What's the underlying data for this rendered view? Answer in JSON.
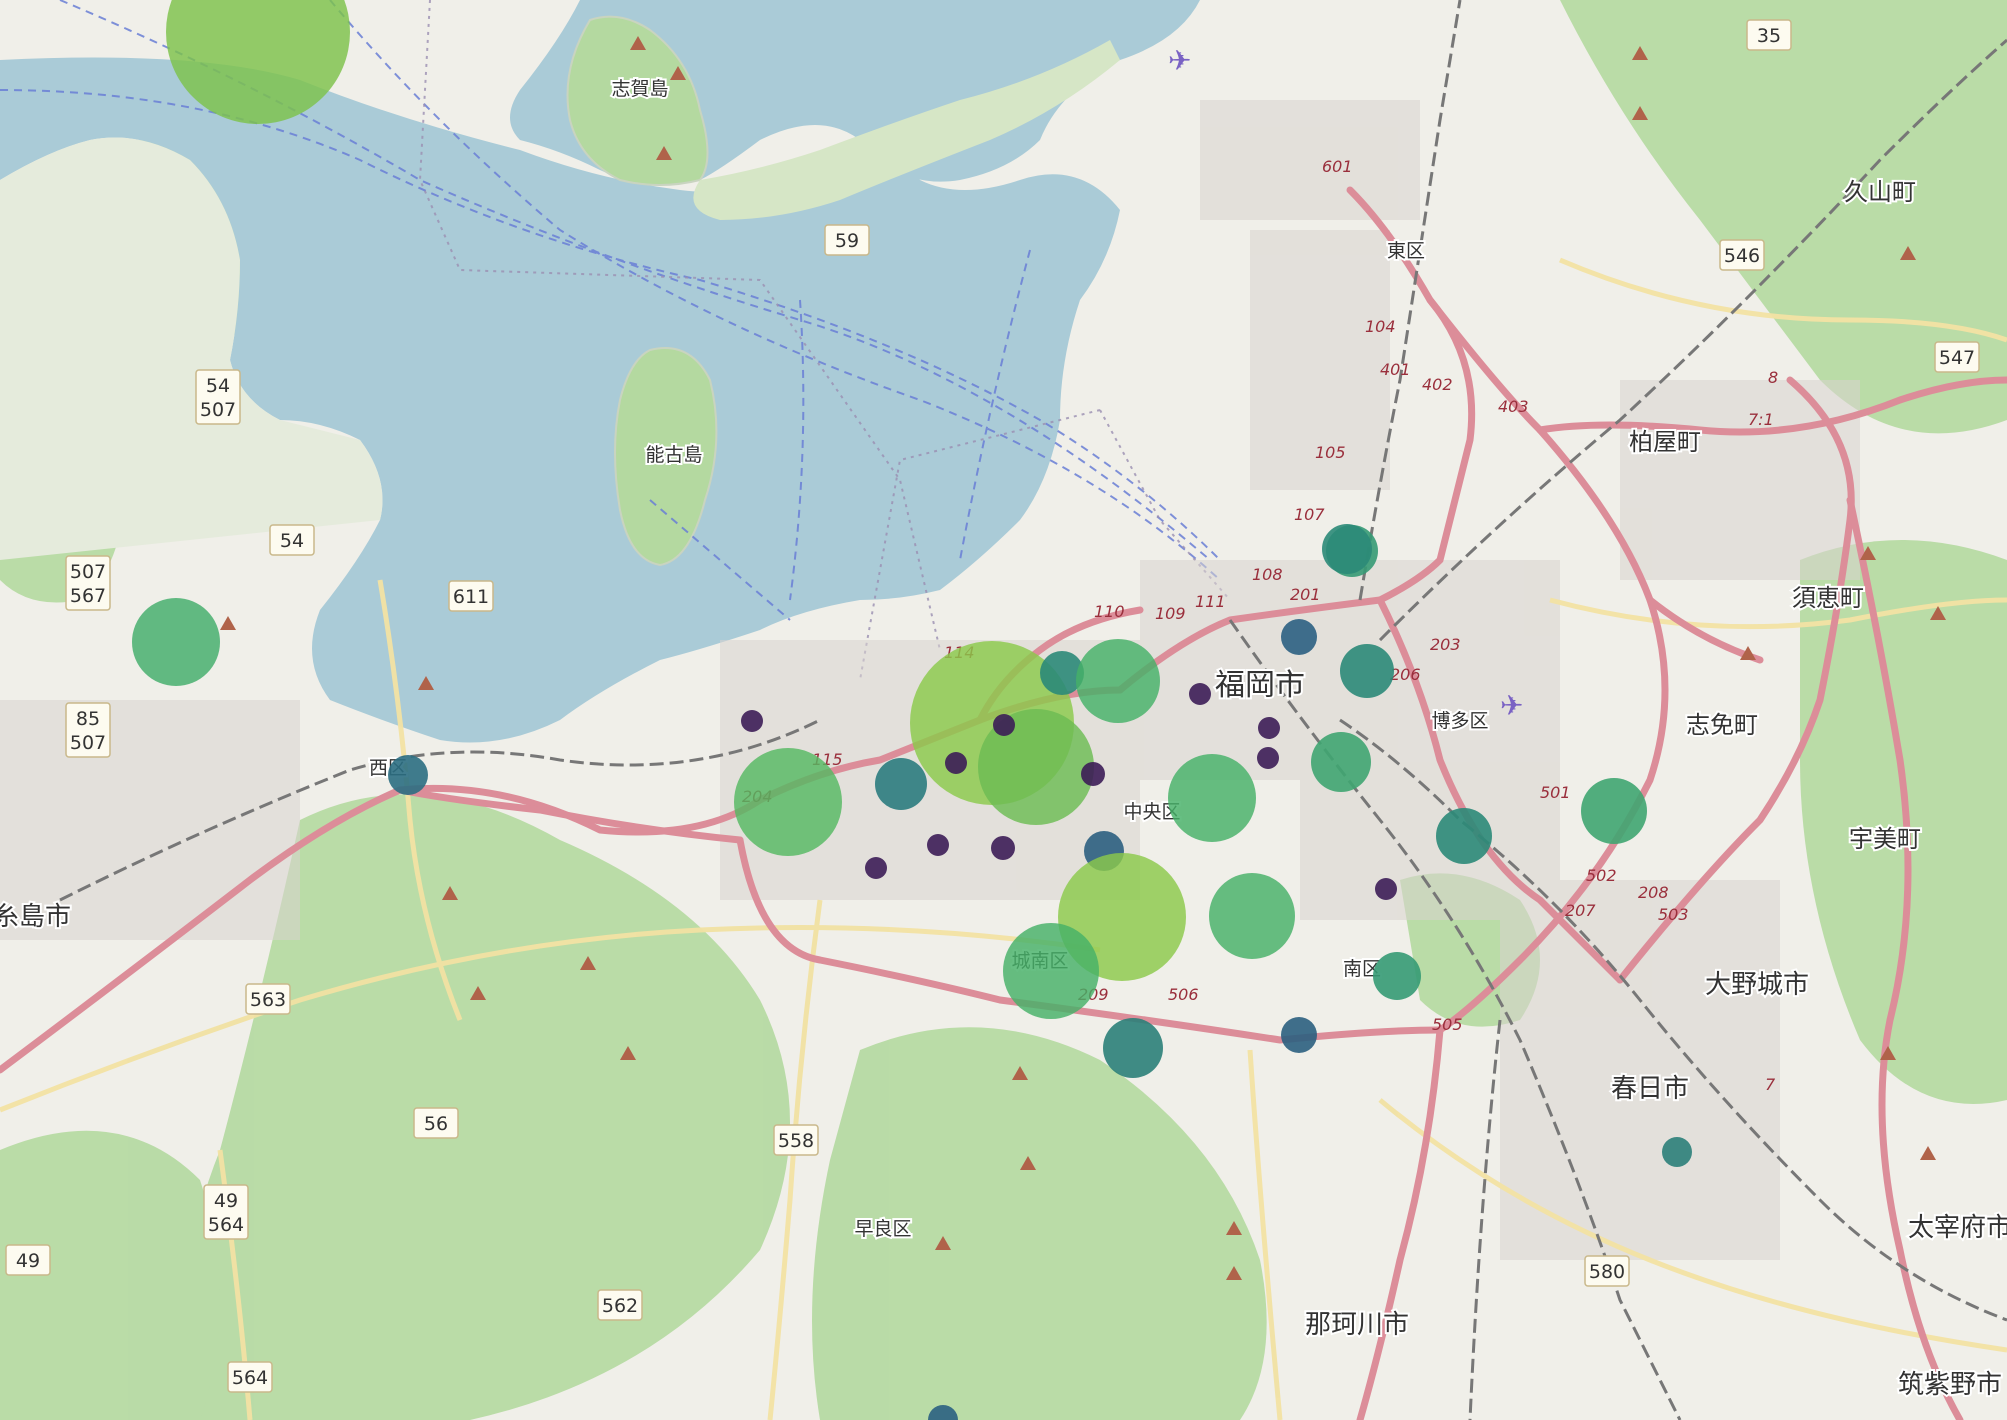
{
  "place_labels": [
    {
      "text": "志賀島",
      "kind": "island"
    },
    {
      "text": "能古島",
      "kind": "island"
    },
    {
      "text": "東区",
      "kind": "ward"
    },
    {
      "text": "福岡市",
      "kind": "city"
    },
    {
      "text": "中央区",
      "kind": "ward"
    },
    {
      "text": "博多区",
      "kind": "ward"
    },
    {
      "text": "城南区",
      "kind": "ward"
    },
    {
      "text": "南区",
      "kind": "ward"
    },
    {
      "text": "早良区",
      "kind": "ward"
    },
    {
      "text": "西区",
      "kind": "ward"
    },
    {
      "text": "糸島市",
      "kind": "city"
    },
    {
      "text": "那珂川市",
      "kind": "city"
    },
    {
      "text": "春日市",
      "kind": "city"
    },
    {
      "text": "大野城市",
      "kind": "city"
    },
    {
      "text": "志免町",
      "kind": "town"
    },
    {
      "text": "宇美町",
      "kind": "town"
    },
    {
      "text": "須恵町",
      "kind": "town"
    },
    {
      "text": "柏屋町",
      "kind": "town"
    },
    {
      "text": "久山町",
      "kind": "town"
    },
    {
      "text": "太宰府市",
      "kind": "city"
    },
    {
      "text": "筑紫野市",
      "kind": "city"
    }
  ],
  "road_shields": [
    "35",
    "546",
    "547",
    "59",
    "54\n507",
    "54",
    "507\n567",
    "611",
    "85\n507",
    "563",
    "56",
    "49\n564",
    "558",
    "562",
    "564",
    "580",
    "49"
  ],
  "route_numbers": [
    "601",
    "104",
    "401",
    "402",
    "403",
    "105",
    "107",
    "108",
    "201",
    "110",
    "109",
    "111",
    "114",
    "115",
    "204",
    "203",
    "206",
    "501",
    "502",
    "207",
    "208",
    "503",
    "505",
    "506",
    "209",
    "7",
    "8",
    "7:1"
  ],
  "palette": {
    "water": "#aacbd7",
    "land": "#f0efe9",
    "forest": "#b4d9a0",
    "major_road": "#dc8d99",
    "secondary_road": "#f2e2a3"
  },
  "bubbles": [
    {
      "value": 9,
      "color": "#7cc24a"
    },
    {
      "value": 6,
      "color": "#41ad6a"
    },
    {
      "value": 1,
      "color": "#2b6e82"
    },
    {
      "value": 0,
      "color": "#3c1d56"
    },
    {
      "value": 7,
      "color": "#55b862"
    },
    {
      "value": 10,
      "color": "#8bc94b"
    },
    {
      "value": 8,
      "color": "#6cbc53"
    },
    {
      "value": 0,
      "color": "#3c1d56"
    },
    {
      "value": 0,
      "color": "#3c1d56"
    },
    {
      "value": 3,
      "color": "#2b8a78"
    },
    {
      "value": 2,
      "color": "#2b7c7e"
    },
    {
      "value": 6,
      "color": "#45b168"
    },
    {
      "value": 0,
      "color": "#3c1d56"
    },
    {
      "value": 0,
      "color": "#3c1d56"
    },
    {
      "value": 0,
      "color": "#3c1d56"
    },
    {
      "value": 4,
      "color": "#359a74"
    },
    {
      "value": 0,
      "color": "#3c1d56"
    },
    {
      "value": 0,
      "color": "#3c1d56"
    },
    {
      "value": 1,
      "color": "#2b5f80"
    },
    {
      "value": 10,
      "color": "#8bc94b"
    },
    {
      "value": 6,
      "color": "#45b168"
    },
    {
      "value": 6,
      "color": "#45b168"
    },
    {
      "value": 6,
      "color": "#45b168"
    },
    {
      "value": 3,
      "color": "#2b8079"
    },
    {
      "value": 0,
      "color": "#3c1d56"
    },
    {
      "value": 0,
      "color": "#3c1d56"
    },
    {
      "value": 5,
      "color": "#3fa571"
    },
    {
      "value": 3,
      "color": "#2b8a78"
    },
    {
      "value": 1,
      "color": "#2b6082"
    },
    {
      "value": 3,
      "color": "#2b8a78"
    },
    {
      "value": 1,
      "color": "#2b5f80"
    },
    {
      "value": 3,
      "color": "#2b8a78"
    },
    {
      "value": 4,
      "color": "#359a74"
    },
    {
      "value": 3,
      "color": "#2b8079"
    },
    {
      "value": 5,
      "color": "#3fa571"
    },
    {
      "value": 0,
      "color": "#3c1d56"
    },
    {
      "value": 1,
      "color": "#2b6082"
    },
    {
      "value": 1,
      "color": "#2b5f80"
    }
  ]
}
